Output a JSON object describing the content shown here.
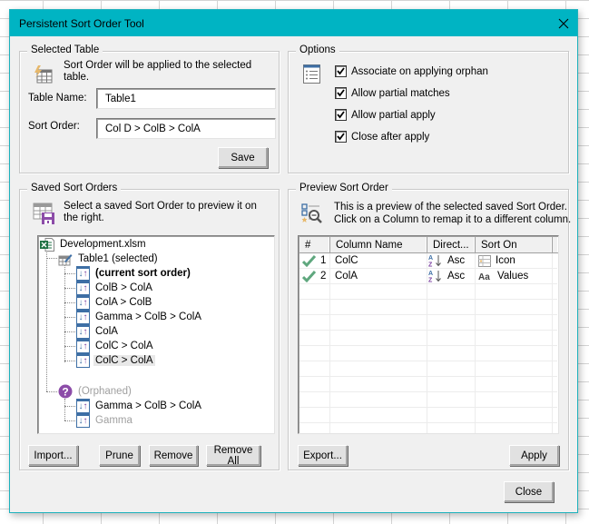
{
  "window": {
    "title": "Persistent Sort Order Tool",
    "accent_color": "#00b4c3"
  },
  "selected_table": {
    "group_label": "Selected Table",
    "description": "Sort Order will be applied to the selected table.",
    "table_name_label": "Table Name:",
    "table_name_value": "Table1",
    "sort_order_label": "Sort Order:",
    "sort_order_value": "Col D > ColB > ColA",
    "save_label": "Save"
  },
  "options": {
    "group_label": "Options",
    "items": [
      {
        "label": "Associate on applying orphan",
        "checked": true
      },
      {
        "label": "Allow partial matches",
        "checked": true
      },
      {
        "label": "Allow partial apply",
        "checked": true
      },
      {
        "label": "Close after apply",
        "checked": true
      }
    ]
  },
  "saved_sort_orders": {
    "group_label": "Saved Sort Orders",
    "description": "Select a saved Sort Order to preview it on the right.",
    "tree": {
      "root": "Development.xlsm",
      "table_node": "Table1 (selected)",
      "table_children": [
        {
          "label": "(current sort order)",
          "style": "bold"
        },
        {
          "label": "ColB > ColA",
          "style": "normal"
        },
        {
          "label": "ColA > ColB",
          "style": "normal"
        },
        {
          "label": "Gamma > ColB > ColA",
          "style": "normal"
        },
        {
          "label": "ColA",
          "style": "normal"
        },
        {
          "label": "ColC > ColA",
          "style": "normal"
        },
        {
          "label": "ColC > ColA",
          "style": "highlighted"
        }
      ],
      "orphaned_node": "(Orphaned)",
      "orphaned_children": [
        {
          "label": "Gamma > ColB > ColA",
          "style": "normal"
        },
        {
          "label": "Gamma",
          "style": "dim"
        }
      ]
    },
    "buttons": {
      "import": "Import...",
      "prune": "Prune",
      "remove": "Remove",
      "remove_all": "Remove All"
    }
  },
  "preview": {
    "group_label": "Preview Sort Order",
    "description_line1": "This is a preview of the selected saved Sort Order.",
    "description_line2": "Click on a Column to remap it to a different column.",
    "columns": [
      "#",
      "Column Name",
      "Direct...",
      "Sort On"
    ],
    "rows": [
      {
        "status_icon": "check-icon",
        "num": "1",
        "column": "ColC",
        "direction_icon": "sort-az-icon",
        "direction": "Asc",
        "sort_on_icon": "cell-icon",
        "sort_on": "Icon"
      },
      {
        "status_icon": "check-icon",
        "num": "2",
        "column": "ColA",
        "direction_icon": "sort-az-icon",
        "direction": "Asc",
        "sort_on_icon": "values-icon",
        "sort_on": "Values"
      }
    ],
    "export_label": "Export...",
    "apply_label": "Apply"
  },
  "footer": {
    "close_label": "Close"
  }
}
